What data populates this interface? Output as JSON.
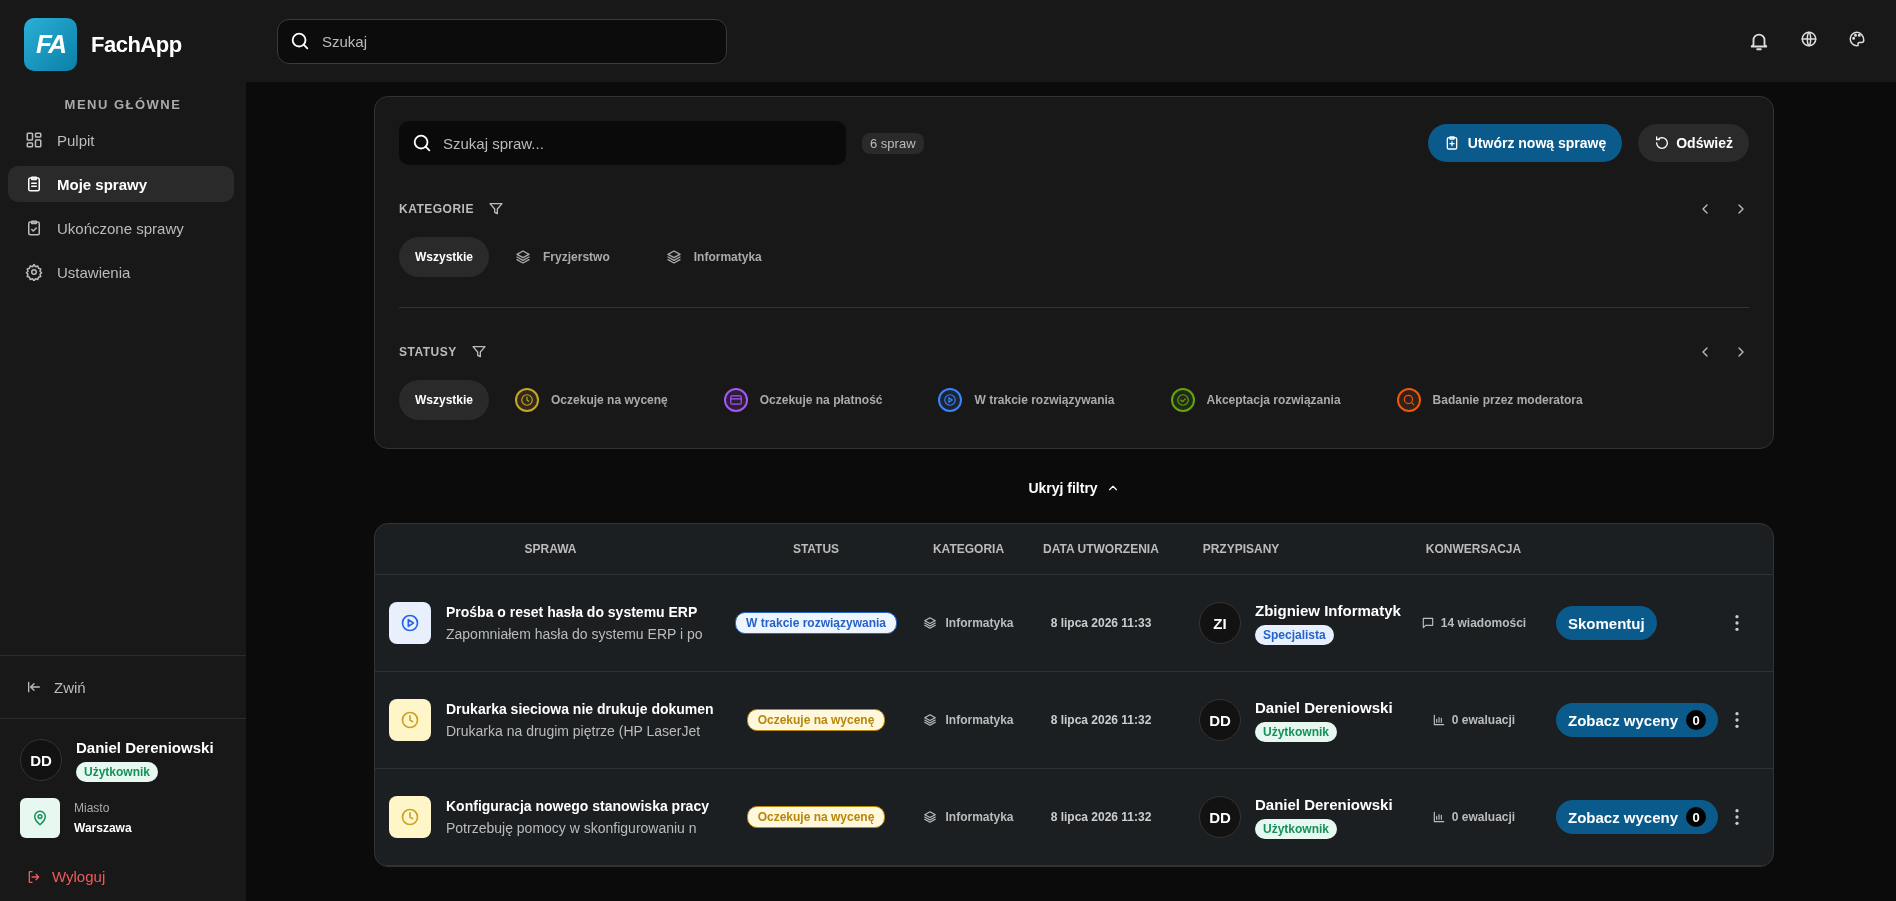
{
  "app": {
    "logo_text": "FA",
    "name": "FachApp"
  },
  "topbar": {
    "search_placeholder": "Szukaj"
  },
  "sidebar": {
    "section_title": "MENU GŁÓWNE",
    "items": [
      {
        "label": "Pulpit",
        "selected": false
      },
      {
        "label": "Moje sprawy",
        "selected": true
      },
      {
        "label": "Ukończone sprawy",
        "selected": false
      },
      {
        "label": "Ustawienia",
        "selected": false
      }
    ],
    "collapse": "Zwiń",
    "user": {
      "initials": "DD",
      "name": "Daniel Dereniowski",
      "role": "Użytkownik"
    },
    "city": {
      "label": "Miasto",
      "value": "Warszawa"
    },
    "logout": "Wyloguj"
  },
  "filters": {
    "search_placeholder": "Szukaj spraw...",
    "count": "6 spraw",
    "create_button": "Utwórz nową sprawę",
    "refresh_button": "Odśwież",
    "categories": {
      "title": "KATEGORIE",
      "items": [
        {
          "label": "Wszystkie",
          "selected": true
        },
        {
          "label": "Fryzjerstwo",
          "selected": false
        },
        {
          "label": "Informatyka",
          "selected": false
        }
      ]
    },
    "statuses": {
      "title": "STATUSY",
      "items": [
        {
          "label": "Wszystkie",
          "selected": true
        },
        {
          "label": "Oczekuje na wycenę",
          "selected": false,
          "color": "#c9a227"
        },
        {
          "label": "Oczekuje na płatność",
          "selected": false,
          "color": "#a855f7"
        },
        {
          "label": "W trakcie rozwiązywania",
          "selected": false,
          "color": "#3b82f6"
        },
        {
          "label": "Akceptacja rozwiązania",
          "selected": false,
          "color": "#65a30d"
        },
        {
          "label": "Badanie przez moderatora",
          "selected": false,
          "color": "#ea580c"
        }
      ]
    },
    "toggle": "Ukryj filtry"
  },
  "table": {
    "columns": [
      "SPRAWA",
      "STATUS",
      "KATEGORIA",
      "DATA UTWORZENIA",
      "PRZYPISANY",
      "KONWERSACJA"
    ],
    "rows": [
      {
        "kind": "in_progress",
        "title": "Prośba o reset hasła do systemu ERP",
        "description": "Zapomniałem hasła do systemu ERP i po",
        "status": "W trakcie rozwiązywania",
        "category": "Informatyka",
        "date": "8 lipca 2026 11:33",
        "assignee": {
          "initials": "ZI",
          "name": "Zbigniew Informatyk",
          "role": "Specjalista",
          "kind": "specialist"
        },
        "conversation": {
          "kind": "messages",
          "text": "14 wiadomości"
        },
        "action": {
          "label": "Skomentuj"
        }
      },
      {
        "kind": "awaiting_quote",
        "title": "Drukarka sieciowa nie drukuje dokumen",
        "description": "Drukarka na drugim piętrze (HP LaserJet",
        "status": "Oczekuje na wycenę",
        "category": "Informatyka",
        "date": "8 lipca 2026 11:32",
        "assignee": {
          "initials": "DD",
          "name": "Daniel Dereniowski",
          "role": "Użytkownik",
          "kind": "user"
        },
        "conversation": {
          "kind": "evaluations",
          "text": "0 ewaluacji"
        },
        "action": {
          "label": "Zobacz wyceny",
          "count": "0"
        }
      },
      {
        "kind": "awaiting_quote",
        "title": "Konfiguracja nowego stanowiska pracy",
        "description": "Potrzebuję pomocy w skonfigurowaniu n",
        "status": "Oczekuje na wycenę",
        "category": "Informatyka",
        "date": "8 lipca 2026 11:32",
        "assignee": {
          "initials": "DD",
          "name": "Daniel Dereniowski",
          "role": "Użytkownik",
          "kind": "user"
        },
        "conversation": {
          "kind": "evaluations",
          "text": "0 ewaluacji"
        },
        "action": {
          "label": "Zobacz wyceny",
          "count": "0"
        }
      }
    ]
  }
}
